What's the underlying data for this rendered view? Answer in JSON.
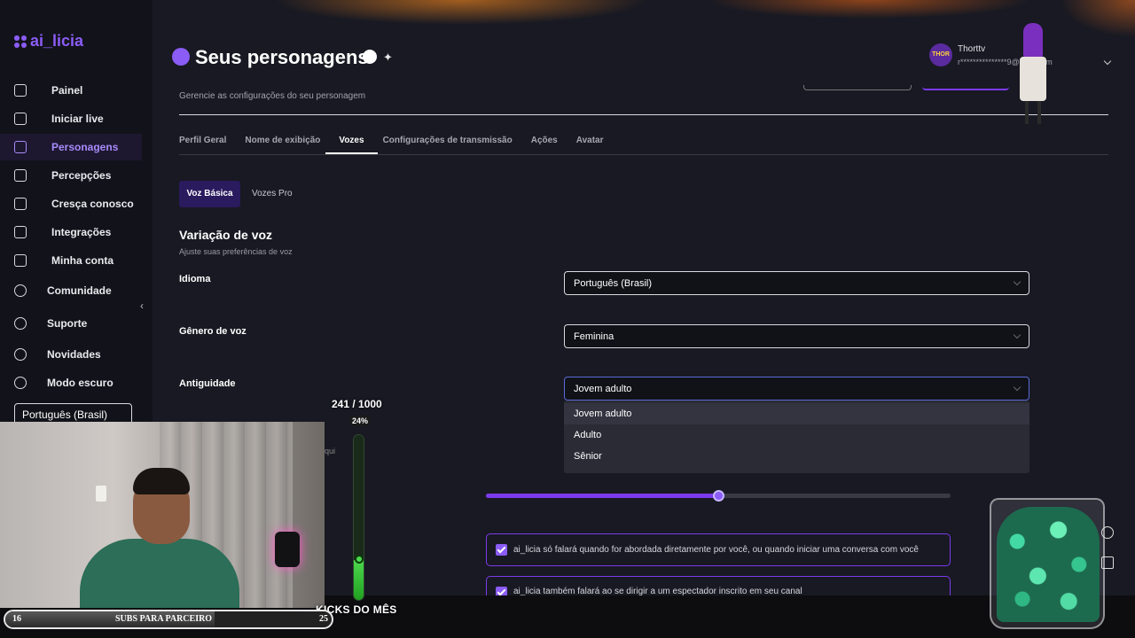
{
  "app": {
    "logo_text": "ai_licia"
  },
  "sidebar": {
    "items": [
      {
        "label": "Painel",
        "icon": "grid-icon"
      },
      {
        "label": "Iniciar live",
        "icon": "broadcast-icon"
      },
      {
        "label": "Personagens",
        "icon": "users-icon",
        "active": true
      },
      {
        "label": "Percepções",
        "icon": "perception-icon"
      },
      {
        "label": "Cresça conosco",
        "icon": "growth-icon"
      },
      {
        "label": "Integrações",
        "icon": "integrations-icon"
      },
      {
        "label": "Minha conta",
        "icon": "user-icon"
      },
      {
        "label": "Comunidade",
        "icon": "community-icon"
      },
      {
        "label": "Suporte",
        "icon": "support-icon"
      },
      {
        "label": "Novidades",
        "icon": "bell-icon"
      },
      {
        "label": "Modo escuro",
        "icon": "moon-icon"
      }
    ],
    "language": "Português (Brasil)"
  },
  "header": {
    "title": "Seus personagens",
    "subtitle": "Gerencie as configurações do seu personagem",
    "user_name": "Thorttv",
    "user_email": "r***************9@g*******m",
    "avatar_text": "THOR"
  },
  "tabs": [
    "Perfil Geral",
    "Nome de exibição",
    "Vozes",
    "Configurações de transmissão",
    "Ações",
    "Avatar"
  ],
  "active_tab": "Vozes",
  "subtabs": [
    "Voz Básica",
    "Vozes Pro"
  ],
  "voice": {
    "section_title": "Variação de voz",
    "section_sub": "Ajuste suas preferências de voz",
    "fields": [
      {
        "label": "Idioma",
        "value": "Português (Brasil)"
      },
      {
        "label": "Gênero de voz",
        "value": "Feminina"
      },
      {
        "label": "Antiguidade",
        "value": "Jovem adulto"
      }
    ],
    "dropdown_options": [
      "Jovem adulto",
      "Adulto",
      "Sênior"
    ],
    "partial_text": "qui",
    "slider_fraction": 0.5
  },
  "checkboxes": [
    {
      "label": "ai_licia só falará quando for abordada diretamente por você, ou quando iniciar uma conversa com você",
      "checked": true
    },
    {
      "label": "ai_licia também falará ao se dirigir a um espectador inscrito em seu canal",
      "checked": true
    }
  ],
  "overlay": {
    "goal_text": "241 / 1000",
    "goal_pct_text": "24%",
    "goal_fraction": 0.24,
    "goal_label": "KICKS DO MÊS",
    "subs_current": "16",
    "subs_label": "SUBS PARA PARCEIRO",
    "subs_target": "25",
    "subs_fraction": 0.64
  },
  "colors": {
    "accent": "#8b5cf6",
    "panel": "#181922",
    "sidebar": "#12131a"
  }
}
